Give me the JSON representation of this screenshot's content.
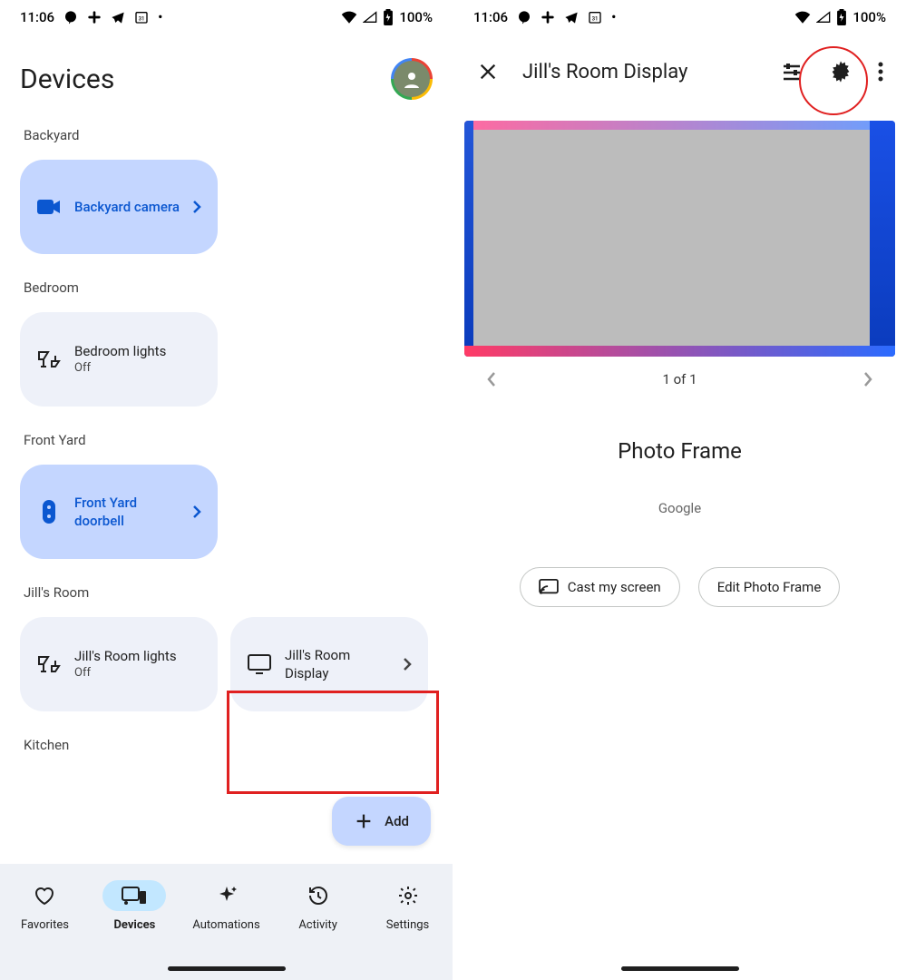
{
  "status": {
    "time": "11:06",
    "battery": "100%"
  },
  "left": {
    "title": "Devices",
    "rooms": {
      "backyard": {
        "label": "Backyard",
        "camera": "Backyard camera"
      },
      "bedroom": {
        "label": "Bedroom",
        "lights": "Bedroom lights",
        "lights_state": "Off"
      },
      "frontyard": {
        "label": "Front Yard",
        "doorbell": "Front Yard doorbell"
      },
      "jill": {
        "label": "Jill's Room",
        "lights": "Jill's Room lights",
        "lights_state": "Off",
        "display": "Jill's Room Display"
      },
      "kitchen": {
        "label": "Kitchen"
      }
    },
    "fab": "Add",
    "nav": {
      "favorites": "Favorites",
      "devices": "Devices",
      "automations": "Automations",
      "activity": "Activity",
      "settings": "Settings"
    }
  },
  "right": {
    "title": "Jill's Room Display",
    "pager": "1 of 1",
    "pf_title": "Photo Frame",
    "pf_sub": "Google",
    "btn_cast": "Cast my screen",
    "btn_edit": "Edit Photo Frame"
  }
}
